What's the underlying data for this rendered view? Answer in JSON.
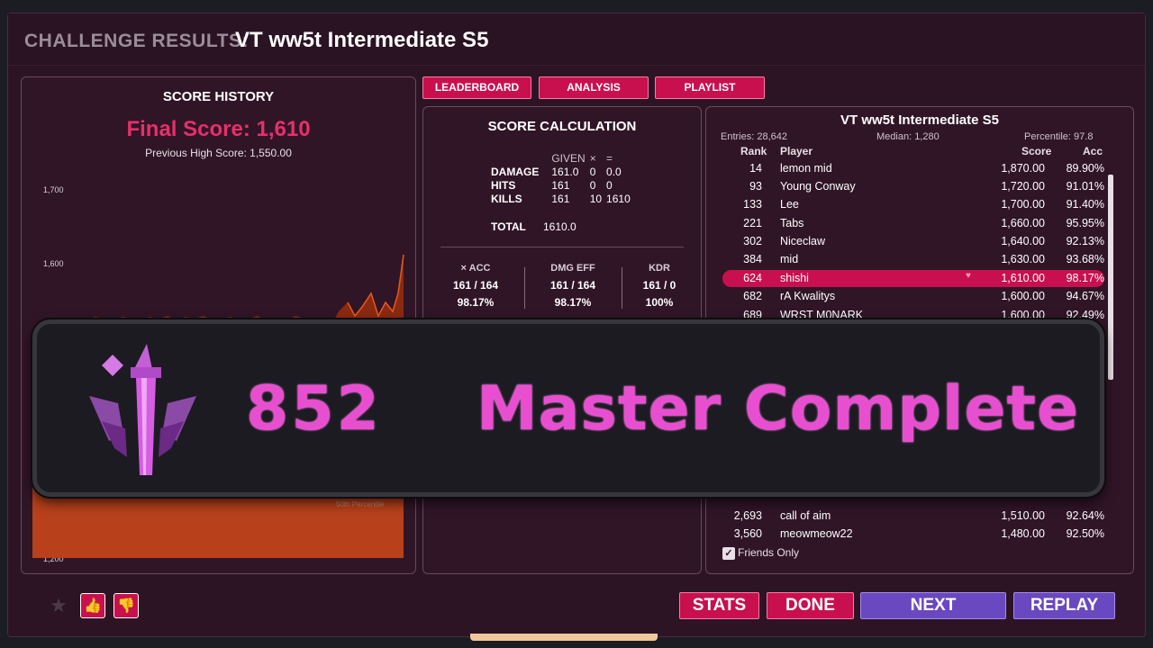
{
  "header": {
    "prefix": "CHALLENGE RESULTS:",
    "name": "VT ww5t Intermediate S5"
  },
  "tabs": [
    {
      "label": "LEADERBOARD"
    },
    {
      "label": "ANALYSIS"
    },
    {
      "label": "PLAYLIST"
    }
  ],
  "history": {
    "title": "SCORE HISTORY",
    "final_score": "Final Score: 1,610",
    "previous_high": "Previous High Score: 1,550.00",
    "y_ticks": [
      "1,700",
      "1,600",
      "1,200"
    ],
    "percentile_label": "50th Percentile"
  },
  "calc": {
    "title": "SCORE CALCULATION",
    "headers": [
      "GIVEN",
      "×",
      "="
    ],
    "rows": [
      {
        "label": "DAMAGE",
        "given": "161.0",
        "mult": "0",
        "result": "0.0"
      },
      {
        "label": "HITS",
        "given": "161",
        "mult": "0",
        "result": "0"
      },
      {
        "label": "KILLS",
        "given": "161",
        "mult": "10",
        "result": "1610"
      }
    ],
    "total_label": "TOTAL",
    "total_value": "1610.0",
    "stats": [
      {
        "head": "× ACC",
        "value": "161 / 164",
        "pct": "98.17%"
      },
      {
        "head": "DMG EFF",
        "value": "161 / 164",
        "pct": "98.17%"
      },
      {
        "head": "KDR",
        "value": "161 / 0",
        "pct": "100%"
      }
    ]
  },
  "board": {
    "title": "VT ww5t Intermediate S5",
    "entries": "Entries: 28,642",
    "median": "Median: 1,280",
    "percentile": "Percentile: 97.8",
    "col_rank": "Rank",
    "col_player": "Player",
    "col_score": "Score",
    "col_acc": "Acc",
    "rows": [
      {
        "rank": "14",
        "player": "lemon mid",
        "score": "1,870.00",
        "acc": "89.90%"
      },
      {
        "rank": "93",
        "player": "Young Conway",
        "score": "1,720.00",
        "acc": "91.01%"
      },
      {
        "rank": "133",
        "player": "Lee",
        "score": "1,700.00",
        "acc": "91.40%"
      },
      {
        "rank": "221",
        "player": "Tabs",
        "score": "1,660.00",
        "acc": "95.95%"
      },
      {
        "rank": "302",
        "player": "Niceclaw",
        "score": "1,640.00",
        "acc": "92.13%"
      },
      {
        "rank": "384",
        "player": "mid",
        "score": "1,630.00",
        "acc": "93.68%"
      },
      {
        "rank": "624",
        "player": "shishi",
        "score": "1,610.00",
        "acc": "98.17%"
      },
      {
        "rank": "682",
        "player": "rA Kwalitys",
        "score": "1,600.00",
        "acc": "94.67%"
      },
      {
        "rank": "689",
        "player": "WRST M0NARK",
        "score": "1,600.00",
        "acc": "92.49%"
      }
    ],
    "bottom_rows": [
      {
        "rank": "2,693",
        "player": "call of aim",
        "score": "1,510.00",
        "acc": "92.64%"
      },
      {
        "rank": "3,560",
        "player": "meowmeow22",
        "score": "1,480.00",
        "acc": "92.50%"
      }
    ],
    "friends_only": "Friends Only"
  },
  "banner": {
    "score": "852",
    "text": "Master Complete"
  },
  "buttons": {
    "stats": "STATS",
    "done": "DONE",
    "next": "NEXT",
    "replay": "REPLAY"
  },
  "colors": {
    "accent": "#c8104e",
    "purple": "#6a48c0",
    "banner_text": "#e84fd0",
    "chart_fill": "#8a2a10"
  }
}
